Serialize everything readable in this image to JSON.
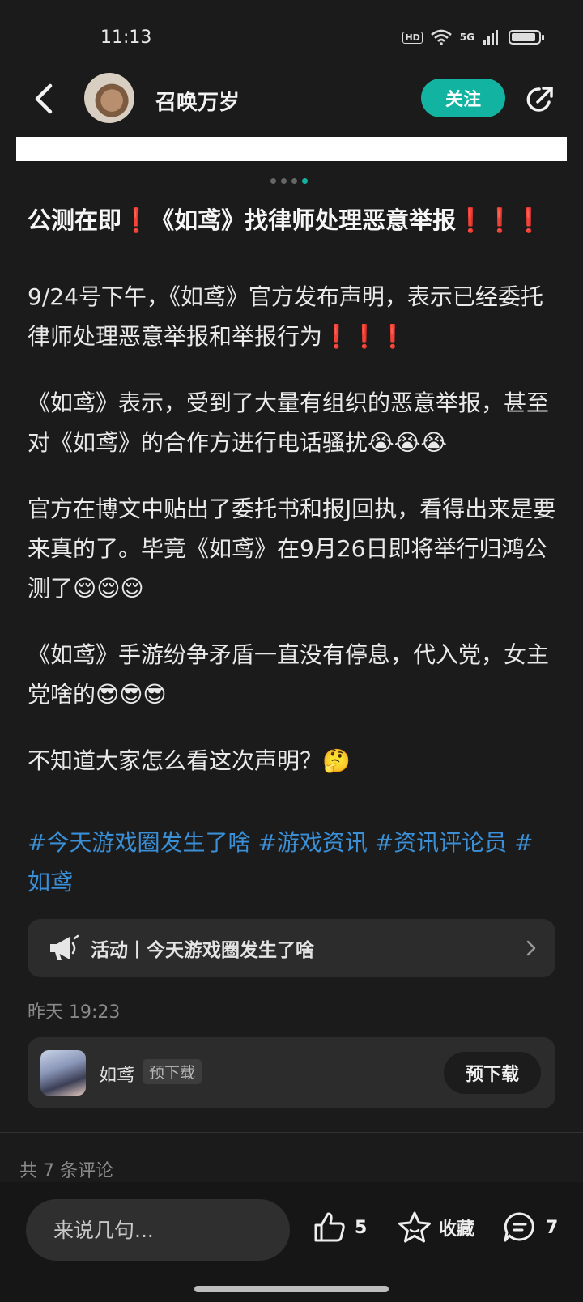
{
  "status_bar": {
    "time": "11:13",
    "hd_label": "HD",
    "network_label": "5G",
    "battery_level": 0.9
  },
  "header": {
    "author_name": "召唤万岁",
    "follow_label": "关注",
    "accent_color": "#12b3a0"
  },
  "carousel": {
    "page_count": 4,
    "active_index": 3
  },
  "post": {
    "title": "公测在即❗《如鸢》找律师处理恶意举报❗❗❗",
    "paragraphs": [
      "9/24号下午，《如鸢》官方发布声明，表示已经委托律师处理恶意举报和举报行为❗❗❗",
      "《如鸢》表示，受到了大量有组织的恶意举报，甚至对《如鸢》的合作方进行电话骚扰😭😭😭",
      "官方在博文中贴出了委托书和报J回执，看得出来是要来真的了。毕竟《如鸢》在9月26日即将举行归鸿公测了😌😌😌",
      "《如鸢》手游纷争矛盾一直没有停息，代入党，女主党啥的😎😎😎",
      "不知道大家怎么看这次声明？🤔"
    ],
    "hashtags": "#今天游戏圈发生了啥 #游戏资讯 #资讯评论员 #如鸢",
    "hashtag_color": "#3a8fd6"
  },
  "activity": {
    "label": "活动丨今天游戏圈发生了啥",
    "icon": "megaphone-icon"
  },
  "post_time": "昨天 19:23",
  "game_card": {
    "name": "如鸢",
    "tag": "预下载",
    "button_label": "预下载"
  },
  "comments_summary": "共 7 条评论",
  "bottom_bar": {
    "comment_placeholder": "来说几句...",
    "like_count": "5",
    "favorite_label": "收藏",
    "comment_count": "7"
  }
}
